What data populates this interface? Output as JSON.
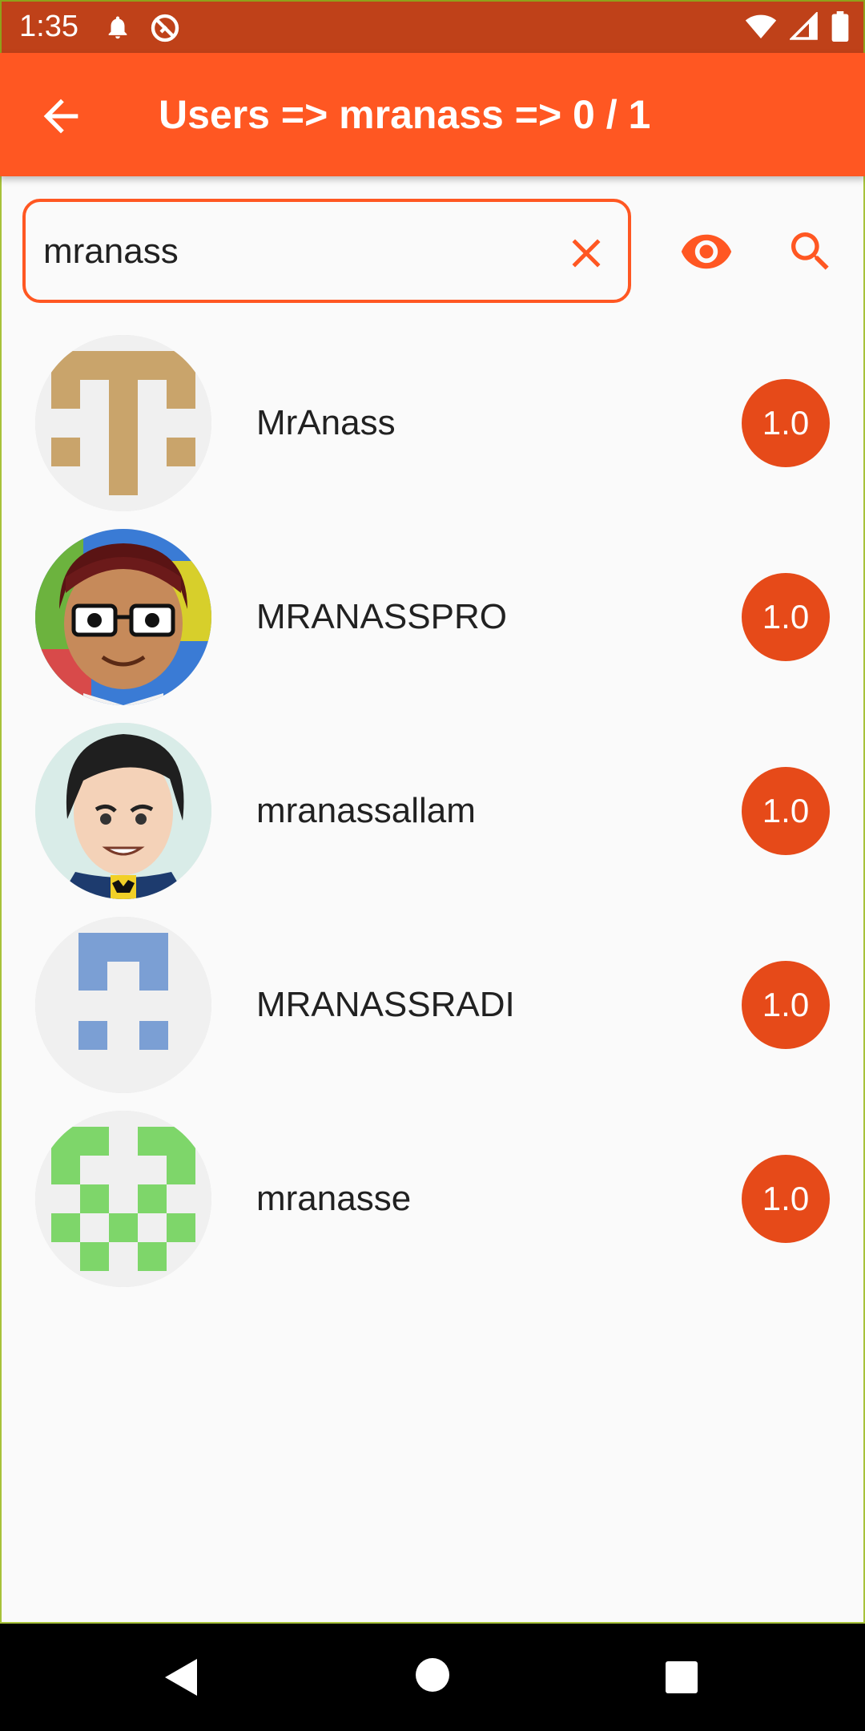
{
  "status_bar": {
    "time": "1:35",
    "icons": [
      "bell-icon",
      "do-not-disturb-icon",
      "wifi-icon",
      "signal-icon",
      "battery-icon"
    ]
  },
  "app_bar": {
    "title": "Users => mranass => 0 / 1",
    "back_icon": "arrow-back-icon"
  },
  "search": {
    "value": "mranass",
    "clear_icon": "close-icon",
    "visibility_icon": "eye-icon",
    "search_icon": "search-icon"
  },
  "users": [
    {
      "name": "MrAnass",
      "score": "1.0",
      "avatar": "identicon-tan"
    },
    {
      "name": "MRANASSPRO",
      "score": "1.0",
      "avatar": "cartoon-glasses"
    },
    {
      "name": "mranassallam",
      "score": "1.0",
      "avatar": "cartoon-dark-hair"
    },
    {
      "name": "MRANASSRADI",
      "score": "1.0",
      "avatar": "identicon-blue"
    },
    {
      "name": "mranasse",
      "score": "1.0",
      "avatar": "identicon-green"
    }
  ],
  "nav_bar": {
    "icons": [
      "nav-back-icon",
      "nav-home-icon",
      "nav-recents-icon"
    ]
  },
  "colors": {
    "primary": "#ff5722",
    "status_bar": "#bf4119",
    "badge": "#e64a19",
    "identicon_tan": "#c9a46b",
    "identicon_blue": "#7b9fd4",
    "identicon_green": "#7ed66a"
  }
}
